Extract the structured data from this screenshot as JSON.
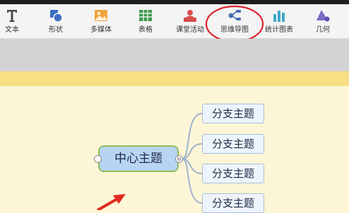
{
  "toolbar": {
    "items": [
      {
        "label": "文本",
        "icon": "text-T-icon"
      },
      {
        "label": "形状",
        "icon": "shapes-icon"
      },
      {
        "label": "多媒体",
        "icon": "image-icon"
      },
      {
        "label": "表格",
        "icon": "table-icon"
      },
      {
        "label": "课堂活动",
        "icon": "classroom-activity-icon"
      },
      {
        "label": "思维导图",
        "icon": "mind-map-icon"
      },
      {
        "label": "统计图表",
        "icon": "bar-chart-icon"
      },
      {
        "label": "几何",
        "icon": "geometry-icon"
      }
    ],
    "highlighted_item": "思维导图",
    "highlight_color": "#d9262b"
  },
  "mindmap": {
    "center": {
      "label": "中心主题"
    },
    "branches": [
      {
        "label": "分支主题"
      },
      {
        "label": "分支主题"
      },
      {
        "label": "分支主题"
      },
      {
        "label": "分支主题"
      }
    ],
    "collapse_symbol": "⊖",
    "accent_color": "#8fbf5a",
    "link_color": "#9fb4cf"
  },
  "annotation": {
    "arrow_color": "#e02b20"
  }
}
